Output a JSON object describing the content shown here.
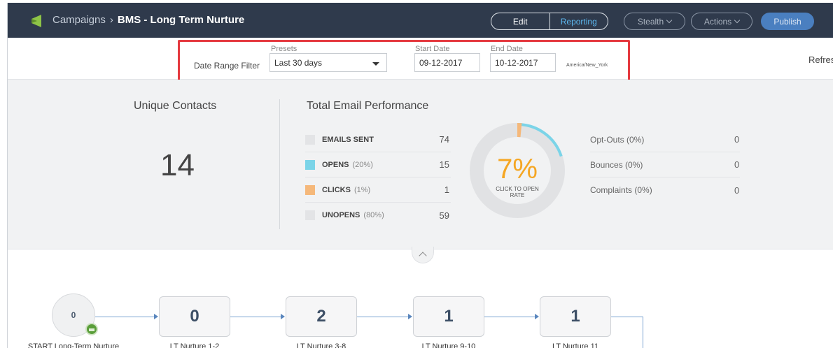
{
  "header": {
    "breadcrumb_root": "Campaigns",
    "breadcrumb_sep": "›",
    "campaign_title": "BMS - Long Term Nurture",
    "edit_label": "Edit",
    "reporting_label": "Reporting",
    "stealth_label": "Stealth",
    "actions_label": "Actions",
    "publish_label": "Publish"
  },
  "filter": {
    "date_range_label": "Date Range Filter",
    "presets_label": "Presets",
    "presets_value": "Last 30 days",
    "start_label": "Start Date",
    "start_value": "09-12-2017",
    "end_label": "End Date",
    "end_value": "10-12-2017",
    "timezone": "America/New_York",
    "refresh_label": "Refresh"
  },
  "stats": {
    "unique_contacts_title": "Unique Contacts",
    "unique_contacts_value": "14",
    "total_email_title": "Total Email Performance",
    "metrics": [
      {
        "label": "EMAILS SENT",
        "pct": "",
        "value": "74",
        "color": "#e3e4e6"
      },
      {
        "label": "OPENS",
        "pct": "(20%)",
        "value": "15",
        "color": "#7bd4e8"
      },
      {
        "label": "CLICKS",
        "pct": "(1%)",
        "value": "1",
        "color": "#f5b87a"
      },
      {
        "label": "UNOPENS",
        "pct": "(80%)",
        "value": "59",
        "color": "#e3e4e6"
      }
    ],
    "click_to_open_rate": "7%",
    "click_to_open_label": "CLICK TO OPEN RATE",
    "click_to_open_fraction": 0.07,
    "opens_fraction": 0.2,
    "side": [
      {
        "label": "Opt-Outs (0%)",
        "value": "0"
      },
      {
        "label": "Bounces (0%)",
        "value": "0"
      },
      {
        "label": "Complaints (0%)",
        "value": "0"
      }
    ]
  },
  "flow": {
    "start_value": "0",
    "start_label": "START Long-Term Nurture",
    "nodes": [
      {
        "value": "0",
        "label": "LT Nurture 1-2"
      },
      {
        "value": "2",
        "label": "LT Nurture 3-8"
      },
      {
        "value": "1",
        "label": "LT Nurture  9-10"
      },
      {
        "value": "1",
        "label": "LT Nurture 11"
      }
    ]
  }
}
